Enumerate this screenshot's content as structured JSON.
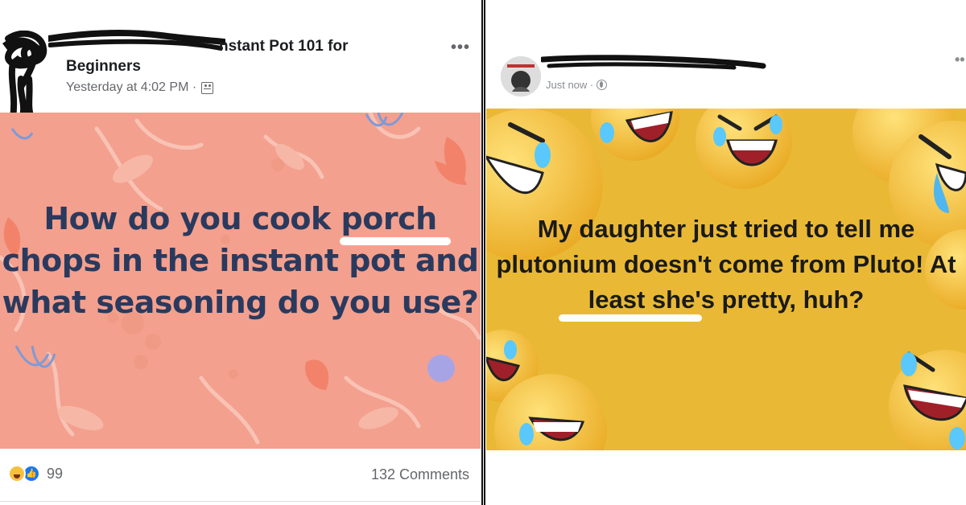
{
  "left_post": {
    "group_name_line1": "nstant Pot 101 for",
    "group_name_line2": "Beginners",
    "timestamp": "Yesterday at 4:02 PM ·",
    "body_text": "How do you cook porch chops in the instant pot and what seasoning do you use?",
    "reaction_count": "99",
    "comments_count": "132 Comments",
    "more_icon": "more-options-icon",
    "background_color": "#f4a08e",
    "text_color": "#2a3a5e"
  },
  "right_post": {
    "timestamp": "Just now ·",
    "body_text": "My daughter just tried to tell me plutonium doesn't come from Pluto! At least she's pretty, huh?",
    "more_icon": "more-options-icon",
    "background_color": "#e7b52f",
    "text_color": "#1a1a1a"
  },
  "icons": {
    "privacy_left": "group-icon",
    "privacy_right": "globe-icon",
    "reactions": [
      "haha-icon",
      "like-icon"
    ]
  }
}
